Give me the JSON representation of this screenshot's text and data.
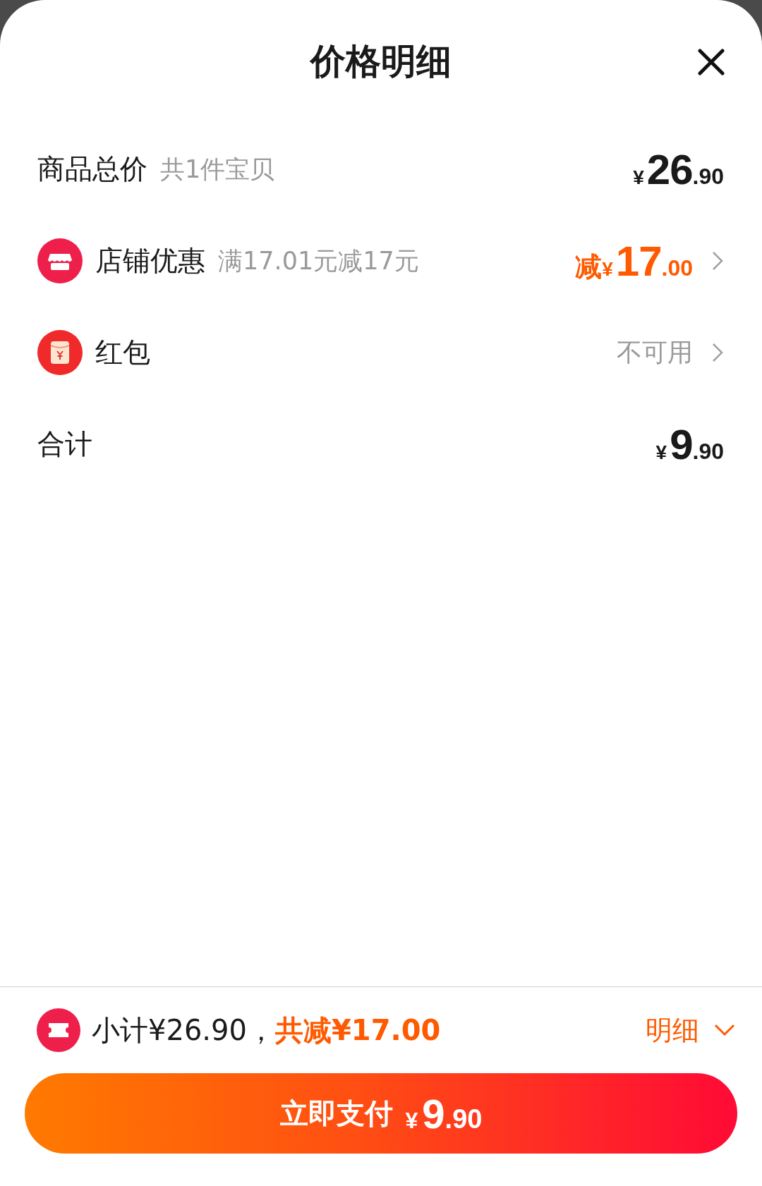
{
  "title": "价格明细",
  "rows": [
    {
      "kind": "total",
      "label": "商品总价",
      "note": "共1件宝贝",
      "price": {
        "currency": "¥",
        "integer": "26",
        "decimal": ".90"
      }
    },
    {
      "kind": "store_discount",
      "label": "店铺优惠",
      "note": "满17.01元减17元",
      "price": {
        "prefix": "减",
        "currency": "¥",
        "integer": "17",
        "decimal": ".00"
      }
    },
    {
      "kind": "red_packet",
      "label": "红包",
      "status": "不可用"
    },
    {
      "kind": "total",
      "label": "合计",
      "price": {
        "currency": "¥",
        "integer": "9",
        "decimal": ".90"
      }
    }
  ],
  "summary": {
    "subtotal": "小计¥26.90，",
    "discount": "共减¥17.00",
    "details": "明细",
    "expanded": true
  },
  "pay_button": {
    "label": "立即支付",
    "price": {
      "currency": "¥",
      "integer": "9",
      "decimal": ".90"
    }
  }
}
